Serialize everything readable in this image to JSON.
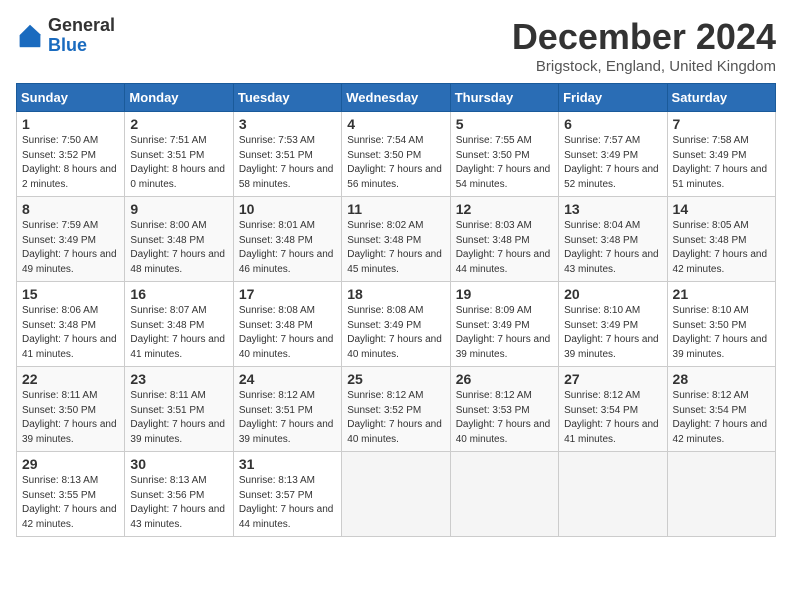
{
  "logo": {
    "general": "General",
    "blue": "Blue"
  },
  "title": "December 2024",
  "location": "Brigstock, England, United Kingdom",
  "headers": [
    "Sunday",
    "Monday",
    "Tuesday",
    "Wednesday",
    "Thursday",
    "Friday",
    "Saturday"
  ],
  "weeks": [
    [
      {
        "day": "1",
        "sunrise": "7:50 AM",
        "sunset": "3:52 PM",
        "daylight": "8 hours and 2 minutes."
      },
      {
        "day": "2",
        "sunrise": "7:51 AM",
        "sunset": "3:51 PM",
        "daylight": "8 hours and 0 minutes."
      },
      {
        "day": "3",
        "sunrise": "7:53 AM",
        "sunset": "3:51 PM",
        "daylight": "7 hours and 58 minutes."
      },
      {
        "day": "4",
        "sunrise": "7:54 AM",
        "sunset": "3:50 PM",
        "daylight": "7 hours and 56 minutes."
      },
      {
        "day": "5",
        "sunrise": "7:55 AM",
        "sunset": "3:50 PM",
        "daylight": "7 hours and 54 minutes."
      },
      {
        "day": "6",
        "sunrise": "7:57 AM",
        "sunset": "3:49 PM",
        "daylight": "7 hours and 52 minutes."
      },
      {
        "day": "7",
        "sunrise": "7:58 AM",
        "sunset": "3:49 PM",
        "daylight": "7 hours and 51 minutes."
      }
    ],
    [
      {
        "day": "8",
        "sunrise": "7:59 AM",
        "sunset": "3:49 PM",
        "daylight": "7 hours and 49 minutes."
      },
      {
        "day": "9",
        "sunrise": "8:00 AM",
        "sunset": "3:48 PM",
        "daylight": "7 hours and 48 minutes."
      },
      {
        "day": "10",
        "sunrise": "8:01 AM",
        "sunset": "3:48 PM",
        "daylight": "7 hours and 46 minutes."
      },
      {
        "day": "11",
        "sunrise": "8:02 AM",
        "sunset": "3:48 PM",
        "daylight": "7 hours and 45 minutes."
      },
      {
        "day": "12",
        "sunrise": "8:03 AM",
        "sunset": "3:48 PM",
        "daylight": "7 hours and 44 minutes."
      },
      {
        "day": "13",
        "sunrise": "8:04 AM",
        "sunset": "3:48 PM",
        "daylight": "7 hours and 43 minutes."
      },
      {
        "day": "14",
        "sunrise": "8:05 AM",
        "sunset": "3:48 PM",
        "daylight": "7 hours and 42 minutes."
      }
    ],
    [
      {
        "day": "15",
        "sunrise": "8:06 AM",
        "sunset": "3:48 PM",
        "daylight": "7 hours and 41 minutes."
      },
      {
        "day": "16",
        "sunrise": "8:07 AM",
        "sunset": "3:48 PM",
        "daylight": "7 hours and 41 minutes."
      },
      {
        "day": "17",
        "sunrise": "8:08 AM",
        "sunset": "3:48 PM",
        "daylight": "7 hours and 40 minutes."
      },
      {
        "day": "18",
        "sunrise": "8:08 AM",
        "sunset": "3:49 PM",
        "daylight": "7 hours and 40 minutes."
      },
      {
        "day": "19",
        "sunrise": "8:09 AM",
        "sunset": "3:49 PM",
        "daylight": "7 hours and 39 minutes."
      },
      {
        "day": "20",
        "sunrise": "8:10 AM",
        "sunset": "3:49 PM",
        "daylight": "7 hours and 39 minutes."
      },
      {
        "day": "21",
        "sunrise": "8:10 AM",
        "sunset": "3:50 PM",
        "daylight": "7 hours and 39 minutes."
      }
    ],
    [
      {
        "day": "22",
        "sunrise": "8:11 AM",
        "sunset": "3:50 PM",
        "daylight": "7 hours and 39 minutes."
      },
      {
        "day": "23",
        "sunrise": "8:11 AM",
        "sunset": "3:51 PM",
        "daylight": "7 hours and 39 minutes."
      },
      {
        "day": "24",
        "sunrise": "8:12 AM",
        "sunset": "3:51 PM",
        "daylight": "7 hours and 39 minutes."
      },
      {
        "day": "25",
        "sunrise": "8:12 AM",
        "sunset": "3:52 PM",
        "daylight": "7 hours and 40 minutes."
      },
      {
        "day": "26",
        "sunrise": "8:12 AM",
        "sunset": "3:53 PM",
        "daylight": "7 hours and 40 minutes."
      },
      {
        "day": "27",
        "sunrise": "8:12 AM",
        "sunset": "3:54 PM",
        "daylight": "7 hours and 41 minutes."
      },
      {
        "day": "28",
        "sunrise": "8:12 AM",
        "sunset": "3:54 PM",
        "daylight": "7 hours and 42 minutes."
      }
    ],
    [
      {
        "day": "29",
        "sunrise": "8:13 AM",
        "sunset": "3:55 PM",
        "daylight": "7 hours and 42 minutes."
      },
      {
        "day": "30",
        "sunrise": "8:13 AM",
        "sunset": "3:56 PM",
        "daylight": "7 hours and 43 minutes."
      },
      {
        "day": "31",
        "sunrise": "8:13 AM",
        "sunset": "3:57 PM",
        "daylight": "7 hours and 44 minutes."
      },
      null,
      null,
      null,
      null
    ]
  ]
}
